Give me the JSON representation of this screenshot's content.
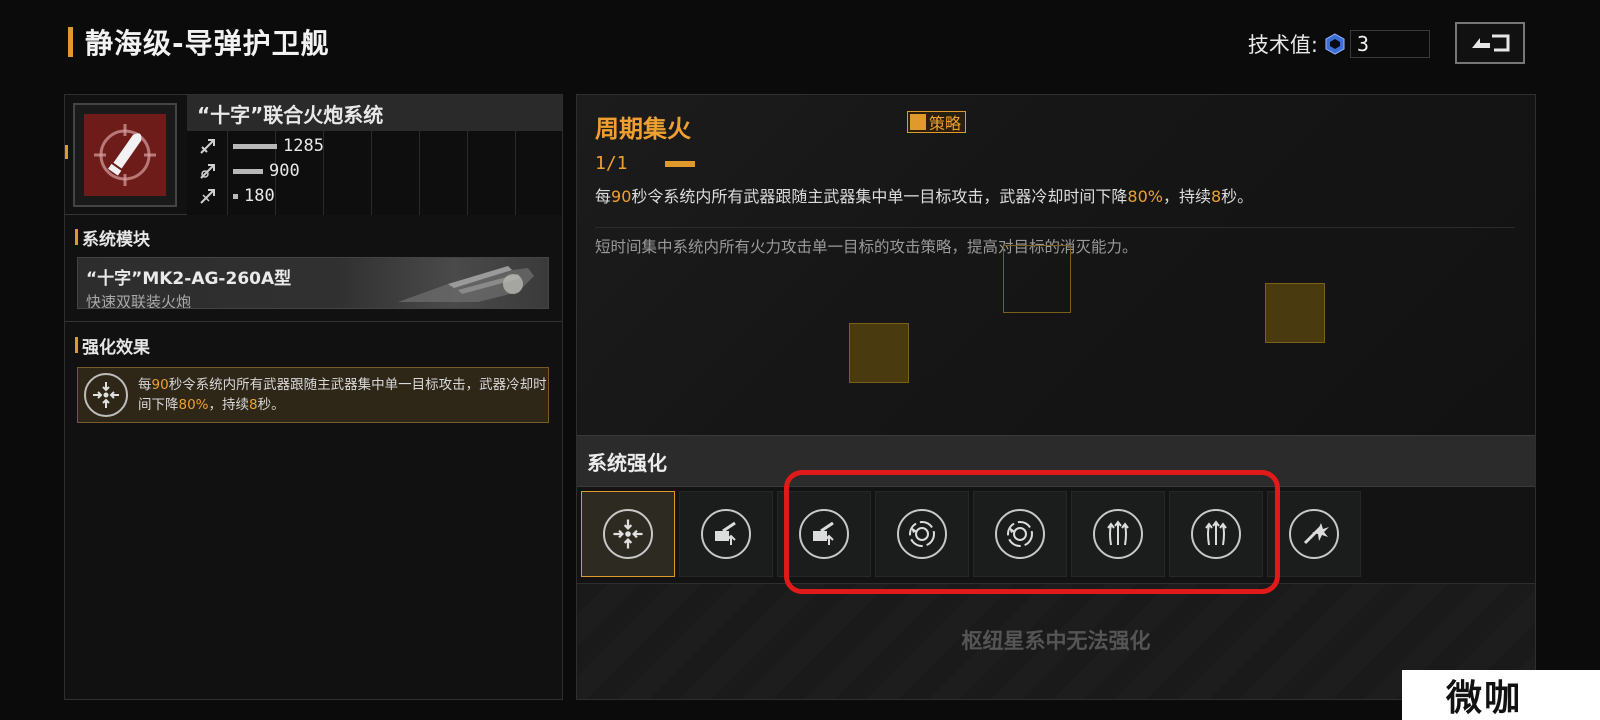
{
  "header": {
    "title": "静海级-导弹护卫舰",
    "tech_label": "技术值:",
    "tech_value": "3"
  },
  "system": {
    "name": "“十字”联合火炮系统",
    "stats": [
      {
        "icon": "damage-icon",
        "value": "1285"
      },
      {
        "icon": "fire-rate-icon",
        "value": "900"
      },
      {
        "icon": "range-icon",
        "value": "180"
      }
    ]
  },
  "module_section": {
    "title": "系统模块",
    "module_name": "“十字”MK2-AG-260A型",
    "module_sub": "快速双联装火炮"
  },
  "effect_section": {
    "title": "强化效果",
    "parts": [
      "每",
      "90",
      "秒令系统内所有武器跟随主武器集中单一目标攻击，武器冷却时间下降",
      "80%",
      "，持续",
      "8",
      "秒。"
    ]
  },
  "strategy": {
    "title": "周期集火",
    "tag": "策略",
    "level": "1/1",
    "desc_parts": [
      "每",
      "90",
      "秒令系统内所有武器跟随主武器集中单一目标攻击，武器冷却时间下降",
      "80%",
      "，持续",
      "8",
      "秒。"
    ],
    "flavor": "短时间集中系统内所有火力攻击单一目标的攻击策略，提高对目标的消灭能力。"
  },
  "enhance": {
    "title": "系统强化",
    "locked_text": "枢纽星系中无法强化",
    "slots": [
      {
        "icon": "focus-fire-icon",
        "active": true
      },
      {
        "icon": "turret-upgrade-icon",
        "active": false
      },
      {
        "icon": "turret-upgrade-icon",
        "active": false
      },
      {
        "icon": "radar-sweep-icon",
        "active": false
      },
      {
        "icon": "radar-sweep-icon",
        "active": false
      },
      {
        "icon": "triple-arrow-up-icon",
        "active": false
      },
      {
        "icon": "triple-arrow-up-icon",
        "active": false
      },
      {
        "icon": "burst-strike-icon",
        "active": false
      }
    ]
  },
  "colors": {
    "accent": "#e09a2c",
    "annotation": "#e01a1a",
    "icon_red": "#6d1c1a"
  },
  "watermark": "微咖"
}
